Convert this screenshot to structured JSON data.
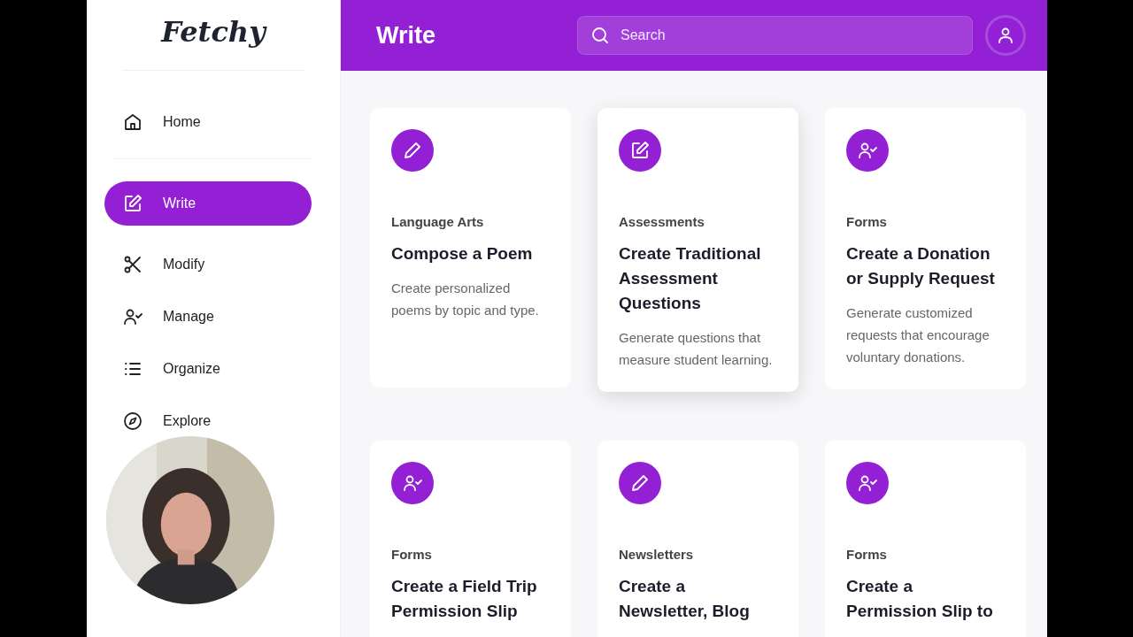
{
  "sidebar": {
    "logo": "Fetchy",
    "items": [
      {
        "label": "Home",
        "kind": "home",
        "selected": false
      },
      {
        "label": "Write",
        "kind": "edit",
        "selected": true
      },
      {
        "label": "Modify",
        "kind": "scissors",
        "selected": false
      },
      {
        "label": "Manage",
        "kind": "user-check",
        "selected": false
      },
      {
        "label": "Organize",
        "kind": "list",
        "selected": false
      },
      {
        "label": "Explore",
        "kind": "compass",
        "selected": false
      }
    ]
  },
  "header": {
    "title": "Write",
    "search": {
      "placeholder": "Search"
    }
  },
  "cards": [
    {
      "kind": "pencil",
      "category": "Language Arts",
      "title": "Compose a Poem",
      "description": "Create personalized poems by topic and type.",
      "hovered": false
    },
    {
      "kind": "edit",
      "category": "Assessments",
      "title": "Create Traditional Assessment Questions",
      "description": "Generate questions that measure student learning.",
      "hovered": true
    },
    {
      "kind": "user-check",
      "category": "Forms",
      "title": "Create a Donation or Supply Request",
      "description": "Generate customized requests that encourage voluntary donations.",
      "hovered": false
    },
    {
      "kind": "user-check",
      "category": "Forms",
      "title": "Create a Field Trip Permission Slip",
      "hovered": false
    },
    {
      "kind": "pencil",
      "category": "Newsletters",
      "title": "Create a Newsletter, Blog",
      "hovered": false
    },
    {
      "kind": "user-check",
      "category": "Forms",
      "title": "Create a Permission Slip to",
      "hovered": false
    }
  ]
}
